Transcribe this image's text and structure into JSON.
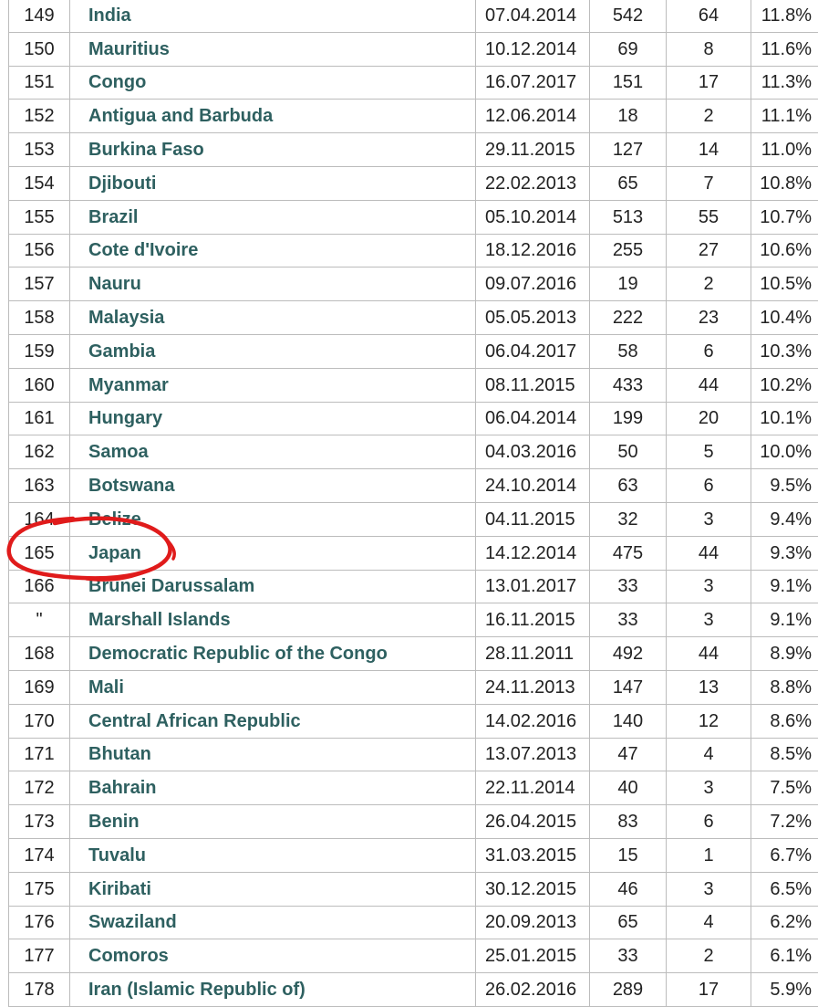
{
  "table": {
    "rows": [
      {
        "rank": "149",
        "country": "India",
        "date": "07.04.2014",
        "seats": "542",
        "women": "64",
        "pct": "11.8%"
      },
      {
        "rank": "150",
        "country": "Mauritius",
        "date": "10.12.2014",
        "seats": "69",
        "women": "8",
        "pct": "11.6%"
      },
      {
        "rank": "151",
        "country": "Congo",
        "date": "16.07.2017",
        "seats": "151",
        "women": "17",
        "pct": "11.3%"
      },
      {
        "rank": "152",
        "country": "Antigua and Barbuda",
        "date": "12.06.2014",
        "seats": "18",
        "women": "2",
        "pct": "11.1%"
      },
      {
        "rank": "153",
        "country": "Burkina Faso",
        "date": "29.11.2015",
        "seats": "127",
        "women": "14",
        "pct": "11.0%"
      },
      {
        "rank": "154",
        "country": "Djibouti",
        "date": "22.02.2013",
        "seats": "65",
        "women": "7",
        "pct": "10.8%"
      },
      {
        "rank": "155",
        "country": "Brazil",
        "date": "05.10.2014",
        "seats": "513",
        "women": "55",
        "pct": "10.7%"
      },
      {
        "rank": "156",
        "country": "Cote d'Ivoire",
        "date": "18.12.2016",
        "seats": "255",
        "women": "27",
        "pct": "10.6%"
      },
      {
        "rank": "157",
        "country": "Nauru",
        "date": "09.07.2016",
        "seats": "19",
        "women": "2",
        "pct": "10.5%"
      },
      {
        "rank": "158",
        "country": "Malaysia",
        "date": "05.05.2013",
        "seats": "222",
        "women": "23",
        "pct": "10.4%"
      },
      {
        "rank": "159",
        "country": "Gambia",
        "date": "06.04.2017",
        "seats": "58",
        "women": "6",
        "pct": "10.3%"
      },
      {
        "rank": "160",
        "country": "Myanmar",
        "date": "08.11.2015",
        "seats": "433",
        "women": "44",
        "pct": "10.2%"
      },
      {
        "rank": "161",
        "country": "Hungary",
        "date": "06.04.2014",
        "seats": "199",
        "women": "20",
        "pct": "10.1%"
      },
      {
        "rank": "162",
        "country": "Samoa",
        "date": "04.03.2016",
        "seats": "50",
        "women": "5",
        "pct": "10.0%"
      },
      {
        "rank": "163",
        "country": "Botswana",
        "date": "24.10.2014",
        "seats": "63",
        "women": "6",
        "pct": "9.5%"
      },
      {
        "rank": "164",
        "country": "Belize",
        "date": "04.11.2015",
        "seats": "32",
        "women": "3",
        "pct": "9.4%"
      },
      {
        "rank": "165",
        "country": "Japan",
        "date": "14.12.2014",
        "seats": "475",
        "women": "44",
        "pct": "9.3%"
      },
      {
        "rank": "166",
        "country": "Brunei Darussalam",
        "date": "13.01.2017",
        "seats": "33",
        "women": "3",
        "pct": "9.1%"
      },
      {
        "rank": "\"",
        "country": "Marshall Islands",
        "date": "16.11.2015",
        "seats": "33",
        "women": "3",
        "pct": "9.1%"
      },
      {
        "rank": "168",
        "country": "Democratic Republic of the Congo",
        "date": "28.11.2011",
        "seats": "492",
        "women": "44",
        "pct": "8.9%"
      },
      {
        "rank": "169",
        "country": "Mali",
        "date": "24.11.2013",
        "seats": "147",
        "women": "13",
        "pct": "8.8%"
      },
      {
        "rank": "170",
        "country": "Central African Republic",
        "date": "14.02.2016",
        "seats": "140",
        "women": "12",
        "pct": "8.6%"
      },
      {
        "rank": "171",
        "country": "Bhutan",
        "date": "13.07.2013",
        "seats": "47",
        "women": "4",
        "pct": "8.5%"
      },
      {
        "rank": "172",
        "country": "Bahrain",
        "date": "22.11.2014",
        "seats": "40",
        "women": "3",
        "pct": "7.5%"
      },
      {
        "rank": "173",
        "country": "Benin",
        "date": "26.04.2015",
        "seats": "83",
        "women": "6",
        "pct": "7.2%"
      },
      {
        "rank": "174",
        "country": "Tuvalu",
        "date": "31.03.2015",
        "seats": "15",
        "women": "1",
        "pct": "6.7%"
      },
      {
        "rank": "175",
        "country": "Kiribati",
        "date": "30.12.2015",
        "seats": "46",
        "women": "3",
        "pct": "6.5%"
      },
      {
        "rank": "176",
        "country": "Swaziland",
        "date": "20.09.2013",
        "seats": "65",
        "women": "4",
        "pct": "6.2%"
      },
      {
        "rank": "177",
        "country": "Comoros",
        "date": "25.01.2015",
        "seats": "33",
        "women": "2",
        "pct": "6.1%"
      },
      {
        "rank": "178",
        "country": "Iran (Islamic Republic of)",
        "date": "26.02.2016",
        "seats": "289",
        "women": "17",
        "pct": "5.9%"
      }
    ]
  },
  "colors": {
    "link": "#2e6060",
    "border": "#bcbcbc",
    "annotation": "#e01b1b"
  },
  "annotation": {
    "shape": "hand-drawn-circle",
    "circled_row_country": "Japan"
  }
}
